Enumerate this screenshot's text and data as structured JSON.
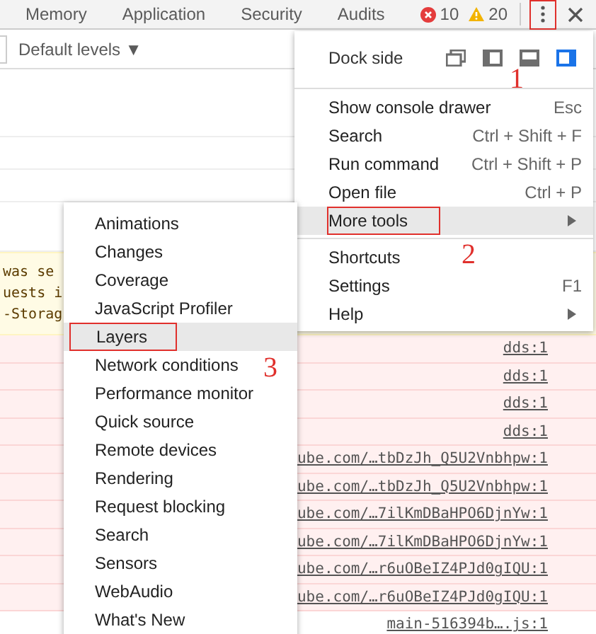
{
  "tabs": [
    {
      "label": "Memory",
      "selected": false
    },
    {
      "label": "Application",
      "selected": false
    },
    {
      "label": "Security",
      "selected": false
    },
    {
      "label": "Audits",
      "selected": false
    }
  ],
  "counters": {
    "errors": "10",
    "warnings": "20"
  },
  "toolbar": {
    "levels": "Default levels ▼"
  },
  "console": {
    "warning_lines": [
      "was se",
      "uests i",
      "-Storag"
    ],
    "rows": [
      {
        "kind": "error",
        "link": "dds:1"
      },
      {
        "kind": "error",
        "link": "dds:1"
      },
      {
        "kind": "error",
        "link": "dds:1"
      },
      {
        "kind": "error",
        "link": "dds:1"
      },
      {
        "kind": "error",
        "link": "ube.com/…tbDzJh_Q5U2Vnbhpw:1"
      },
      {
        "kind": "error",
        "link": "ube.com/…tbDzJh_Q5U2Vnbhpw:1"
      },
      {
        "kind": "error",
        "link": "ube.com/…7ilKmDBaHPO6DjnYw:1"
      },
      {
        "kind": "error",
        "link": "ube.com/…7ilKmDBaHPO6DjnYw:1"
      },
      {
        "kind": "error",
        "link": "ube.com/…r6uOBeIZ4PJd0gIQU:1"
      },
      {
        "kind": "error",
        "link": "ube.com/…r6uOBeIZ4PJd0gIQU:1"
      },
      {
        "kind": "info",
        "link": "main-516394b….js:1"
      }
    ]
  },
  "menu": {
    "dock_side": {
      "label": "Dock side",
      "options": [
        {
          "kind": "undock",
          "selected": false
        },
        {
          "kind": "left",
          "selected": false
        },
        {
          "kind": "bottom",
          "selected": false
        },
        {
          "kind": "right",
          "selected": true
        }
      ]
    },
    "groups": [
      [
        {
          "label": "Show console drawer",
          "shortcut": "Esc",
          "selected": false,
          "submenu": false,
          "annotated": false
        },
        {
          "label": "Search",
          "shortcut": "Ctrl + Shift + F",
          "selected": false,
          "submenu": false,
          "annotated": false
        },
        {
          "label": "Run command",
          "shortcut": "Ctrl + Shift + P",
          "selected": false,
          "submenu": false,
          "annotated": false
        },
        {
          "label": "Open file",
          "shortcut": "Ctrl + P",
          "selected": false,
          "submenu": false,
          "annotated": false
        },
        {
          "label": "More tools",
          "selected": true,
          "submenu": true,
          "annotated": true
        }
      ],
      [
        {
          "label": "Shortcuts",
          "selected": false,
          "submenu": false,
          "annotated": false
        },
        {
          "label": "Settings",
          "shortcut": "F1",
          "selected": false,
          "submenu": false,
          "annotated": false
        },
        {
          "label": "Help",
          "selected": false,
          "submenu": true,
          "annotated": false
        }
      ]
    ]
  },
  "submenu": [
    {
      "label": "Animations",
      "selected": false,
      "annotated": false
    },
    {
      "label": "Changes",
      "selected": false,
      "annotated": false
    },
    {
      "label": "Coverage",
      "selected": false,
      "annotated": false
    },
    {
      "label": "JavaScript Profiler",
      "selected": false,
      "annotated": false
    },
    {
      "label": "Layers",
      "selected": true,
      "annotated": true
    },
    {
      "label": "Network conditions",
      "selected": false,
      "annotated": false
    },
    {
      "label": "Performance monitor",
      "selected": false,
      "annotated": false
    },
    {
      "label": "Quick source",
      "selected": false,
      "annotated": false
    },
    {
      "label": "Remote devices",
      "selected": false,
      "annotated": false
    },
    {
      "label": "Rendering",
      "selected": false,
      "annotated": false
    },
    {
      "label": "Request blocking",
      "selected": false,
      "annotated": false
    },
    {
      "label": "Search",
      "selected": false,
      "annotated": false
    },
    {
      "label": "Sensors",
      "selected": false,
      "annotated": false
    },
    {
      "label": "WebAudio",
      "selected": false,
      "annotated": false
    },
    {
      "label": "What's New",
      "selected": false,
      "annotated": false
    }
  ],
  "annotations": [
    "1",
    "2",
    "3"
  ],
  "menu_button_annotated": true
}
